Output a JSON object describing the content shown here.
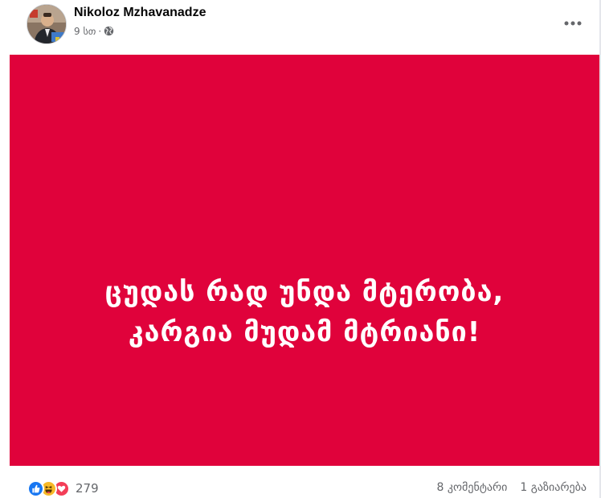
{
  "post": {
    "author": "Nikoloz Mzhavanadze",
    "time": "9 სთ",
    "separator": "·",
    "audience_icon": "globe-icon",
    "more_icon": "more-horizontal-icon",
    "image": {
      "background_color": "#e0023b",
      "text_color": "#ffffff",
      "lines": [
        "ცუდას რად უნდა მტერობა,",
        "კარგია მუდამ მტრიანი!"
      ]
    }
  },
  "footer": {
    "reactions": [
      {
        "name": "like-icon",
        "color": "#1877f2"
      },
      {
        "name": "haha-icon",
        "color": "#f7b928"
      },
      {
        "name": "love-icon",
        "color": "#f33e58"
      }
    ],
    "reaction_count": "279",
    "comments": "8 კომენტარი",
    "shares": "1 გაზიარება"
  },
  "colors": {
    "secondary_text": "#65676b",
    "primary_text": "#050505"
  }
}
